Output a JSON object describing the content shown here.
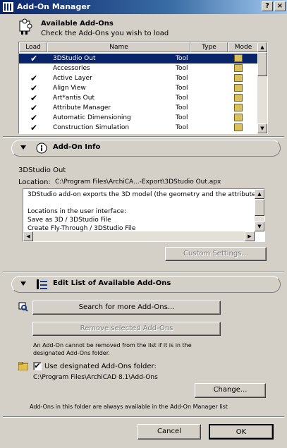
{
  "window": {
    "title": "Add-On Manager",
    "help_btn": "?",
    "close_btn": "×"
  },
  "header": {
    "title": "Available Add-Ons",
    "subtitle": "Check the Add-Ons you wish to load"
  },
  "table": {
    "columns": [
      "Load",
      "Name",
      "Type",
      "Mode"
    ],
    "rows": [
      {
        "checked": "✔",
        "name": "3DStudio Out",
        "type": "Tool",
        "selected": true
      },
      {
        "checked": "",
        "name": "Accessories",
        "type": "Tool",
        "selected": false
      },
      {
        "checked": "✔",
        "name": "Active Layer",
        "type": "Tool",
        "selected": false
      },
      {
        "checked": "✔",
        "name": "Align View",
        "type": "Tool",
        "selected": false
      },
      {
        "checked": "✔",
        "name": "Art*antis Out",
        "type": "Tool",
        "selected": false
      },
      {
        "checked": "✔",
        "name": "Attribute Manager",
        "type": "Tool",
        "selected": false
      },
      {
        "checked": "✔",
        "name": "Automatic Dimensioning",
        "type": "Tool",
        "selected": false
      },
      {
        "checked": "✔",
        "name": "Construction Simulation",
        "type": "Tool",
        "selected": false
      }
    ]
  },
  "info": {
    "section_title": "Add-On Info",
    "addon_name": "3DStudio Out",
    "location_label": "Location:",
    "location_value": "C:\\Program Files\\ArchiCA...-Export\\3DStudio Out.apx",
    "description": "3DStudio add-on exports the 3D model (the geometry and the attributes)\n\nLocations in the user interface:\nSave as 3D / 3DStudio File\nCreate Fly-Through / 3DStudio File",
    "custom_settings": "Custom Settings..."
  },
  "edit": {
    "section_title": "Edit List of Available Add-Ons",
    "search_btn": "Search for more Add-Ons...",
    "remove_btn": "Remove selected Add-Ons",
    "note_line1": "An Add-On cannot be removed from the list if it is in the",
    "note_line2": "designated Add-Ons folder.",
    "use_folder_label": "Use designated Add-Ons folder:",
    "use_folder_checked": "✔",
    "folder_path": "C:\\Program Files\\ArchiCAD 8.1\\Add-Ons",
    "change_btn": "Change...",
    "folder_note": "Add-Ons in this folder are always available in the Add-On Manager list"
  },
  "footer": {
    "cancel": "Cancel",
    "ok": "OK"
  }
}
